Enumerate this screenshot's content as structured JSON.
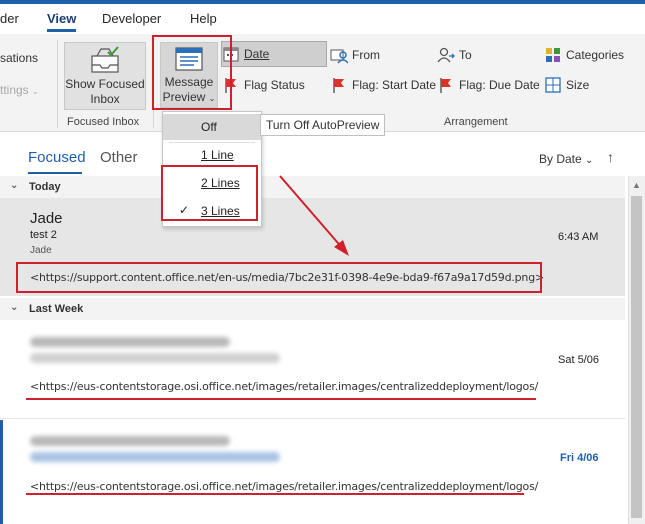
{
  "menu": {
    "tabs": [
      {
        "label": "der"
      },
      {
        "label": "View",
        "active": true
      },
      {
        "label": "Developer"
      },
      {
        "label": "Help"
      }
    ]
  },
  "ribbon": {
    "left_partial": {
      "line1": "sations",
      "line2": "ttings"
    },
    "show_focused_inbox": {
      "line1": "Show Focused",
      "line2": "Inbox"
    },
    "message_preview": {
      "line1": "Message",
      "line2": "Preview"
    },
    "focused_inbox_group": "Focused Inbox",
    "arrangement_group": "Arrangement",
    "arrangement": {
      "date": "Date",
      "from": "From",
      "to": "To",
      "categories": "Categories",
      "flag_status": "Flag Status",
      "flag_start": "Flag: Start Date",
      "flag_due": "Flag: Due Date",
      "size": "Size"
    }
  },
  "dropdown": {
    "items": [
      {
        "label": "Off",
        "hover": true
      },
      {
        "label": "1 Line"
      },
      {
        "label": "2 Lines"
      },
      {
        "label": "3 Lines",
        "checked": true
      }
    ],
    "tooltip": "Turn Off AutoPreview"
  },
  "list": {
    "tab_focused": "Focused",
    "tab_other": "Other",
    "sort_label": "By Date",
    "groups": {
      "today": "Today",
      "last_week": "Last Week"
    },
    "messages": [
      {
        "sender": "Jade",
        "subject": "test 2",
        "preview": "Jade",
        "url": "<https://support.content.office.net/en-us/media/7bc2e31f-0398-4e9e-bda9-f67a9a17d59d.png>",
        "time": "6:43 AM"
      },
      {
        "url": "<https://eus-contentstorage.osi.office.net/images/retailer.images/centralizeddeployment/logos/",
        "time": "Sat 5/06"
      },
      {
        "url": "<https://eus-contentstorage.osi.office.net/images/retailer.images/centralizeddeployment/logos/",
        "time": "Fri 4/06"
      }
    ]
  },
  "colors": {
    "accent": "#1f5fa8",
    "annotation_red": "#d0202c",
    "flag_red": "#d9342b"
  }
}
